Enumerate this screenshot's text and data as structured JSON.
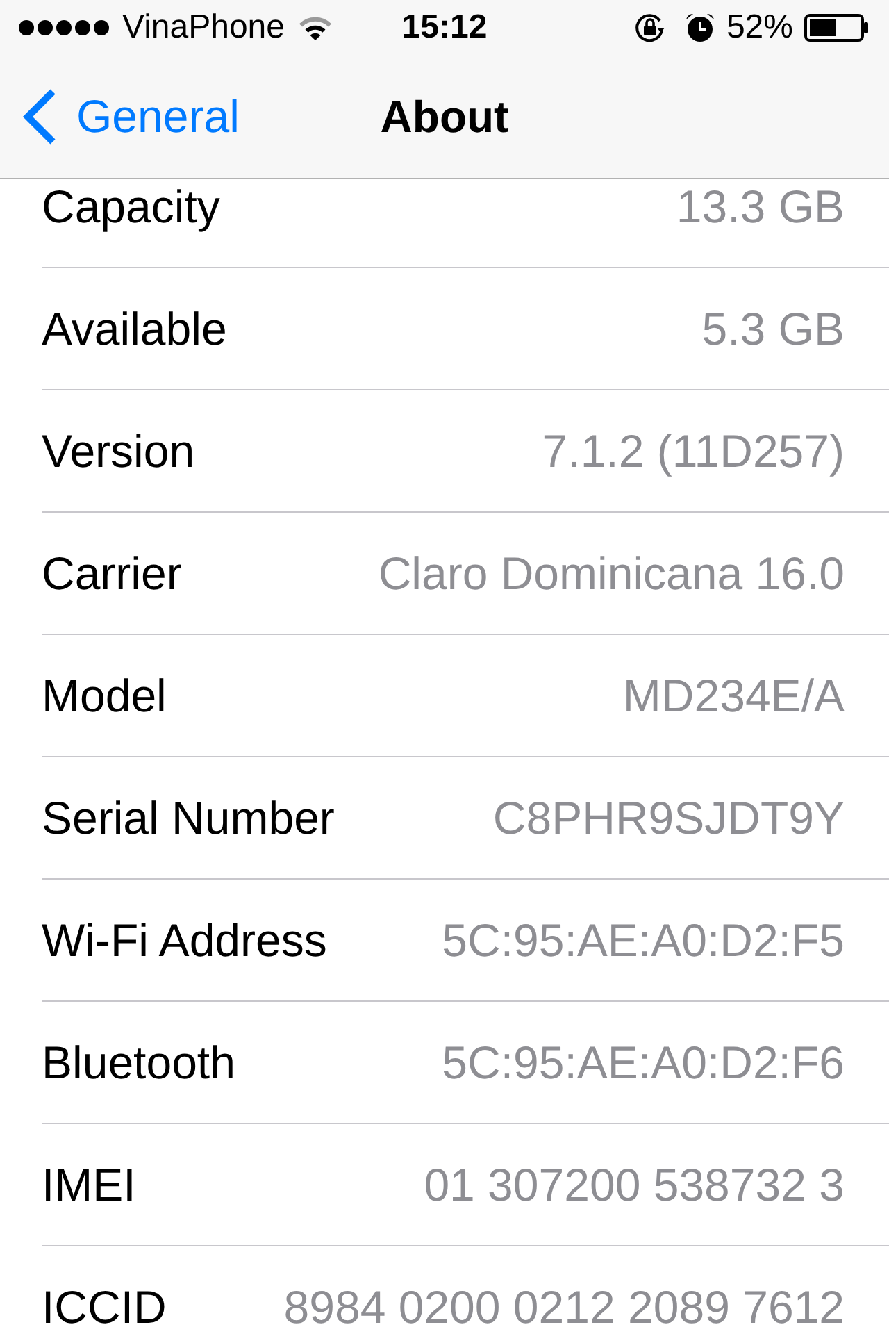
{
  "status_bar": {
    "carrier": "VinaPhone",
    "time": "15:12",
    "battery_percent": "52%"
  },
  "nav_bar": {
    "back_label": "General",
    "title": "About"
  },
  "rows": [
    {
      "label": "Capacity",
      "value": "13.3 GB"
    },
    {
      "label": "Available",
      "value": "5.3 GB"
    },
    {
      "label": "Version",
      "value": "7.1.2 (11D257)"
    },
    {
      "label": "Carrier",
      "value": "Claro Dominicana 16.0"
    },
    {
      "label": "Model",
      "value": "MD234E/A"
    },
    {
      "label": "Serial Number",
      "value": "C8PHR9SJDT9Y"
    },
    {
      "label": "Wi-Fi Address",
      "value": "5C:95:AE:A0:D2:F5"
    },
    {
      "label": "Bluetooth",
      "value": "5C:95:AE:A0:D2:F6"
    },
    {
      "label": "IMEI",
      "value": "01 307200 538732 3"
    },
    {
      "label": "ICCID",
      "value": "8984 0200 0212 2089 7612"
    }
  ]
}
